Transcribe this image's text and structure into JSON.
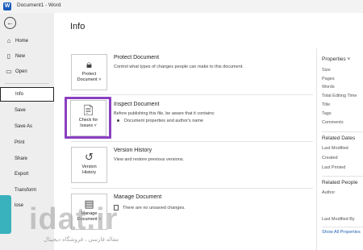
{
  "titlebar": {
    "app_icon": "word-icon",
    "app_letter": "W",
    "title": "Document1 - Word"
  },
  "sidebar": {
    "back_icon": "back-arrow-icon",
    "items": [
      {
        "label": "Home",
        "icon": "home-icon"
      },
      {
        "label": "New",
        "icon": "new-document-icon"
      },
      {
        "label": "Open",
        "icon": "folder-icon"
      },
      {
        "label": "Info"
      },
      {
        "label": "Save"
      },
      {
        "label": "Save As"
      },
      {
        "label": "Print"
      },
      {
        "label": "Share"
      },
      {
        "label": "Export"
      },
      {
        "label": "Transform"
      },
      {
        "label": "lose"
      }
    ],
    "selected": "Info"
  },
  "main": {
    "title": "Info",
    "sections": [
      {
        "button_line1": "Protect",
        "button_line2": "Document ˅",
        "icon": "lock-icon",
        "title": "Protect Document",
        "desc": "Control what types of changes people can make to this document."
      },
      {
        "button_line1": "Check for",
        "button_line2": "Issues ˅",
        "icon": "inspect-document-icon",
        "title": "Inspect Document",
        "desc": "Before publishing this file, be aware that it contains:",
        "bullet": "Document properties and author's name"
      },
      {
        "button_line1": "Version",
        "button_line2": "History",
        "icon": "history-icon",
        "title": "Version History",
        "desc": "View and restore previous versions."
      },
      {
        "button_line1": "Manage",
        "button_line2": "Document ˅",
        "icon": "manage-document-icon",
        "title": "Manage Document",
        "desc": "There are no unsaved changes."
      }
    ]
  },
  "right_panel": {
    "properties_label": "Properties ˅",
    "properties": [
      "Size",
      "Pages",
      "Words",
      "Total Editing Time",
      "Title",
      "Tags",
      "Comments"
    ],
    "related_dates_label": "Related Dates",
    "dates": [
      "Last Modified",
      "Created",
      "Last Printed"
    ],
    "related_people_label": "Related People",
    "people": [
      "Author",
      "Last Modified By"
    ],
    "show_all": "Show All Properties"
  },
  "watermark": {
    "text": "idat.ir",
    "subtitle": "مقاله فارسی ، فروشگاه دیجیتال"
  },
  "colors": {
    "highlight": "#8a3fc0",
    "word_blue": "#185abd",
    "link": "#1f5fb4",
    "sidebar_bg": "#eeeeee"
  }
}
